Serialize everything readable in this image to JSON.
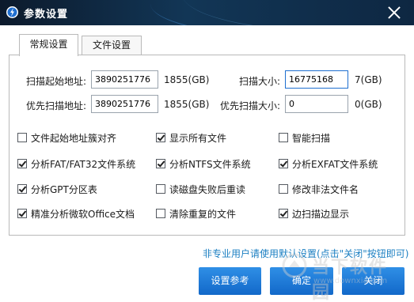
{
  "window": {
    "title": "参数设置"
  },
  "tabs": [
    {
      "label": "常规设置",
      "active": true
    },
    {
      "label": "文件设置",
      "active": false
    }
  ],
  "fields": {
    "scan_start": {
      "label": "扫描起始地址:",
      "value": "3890251776",
      "size": "1855(GB)"
    },
    "scan_size": {
      "label": "扫描大小:",
      "value": "16775168",
      "size": "7(GB)"
    },
    "priority_start": {
      "label": "优先扫描地址:",
      "value": "3890251776",
      "size": "1855(GB)"
    },
    "priority_size": {
      "label": "优先扫描大小:",
      "value": "0",
      "size": "0(GB)"
    }
  },
  "options": [
    {
      "label": "文件起始地址簇对齐",
      "checked": false
    },
    {
      "label": "显示所有文件",
      "checked": true
    },
    {
      "label": "智能扫描",
      "checked": false
    },
    {
      "label": "分析FAT/FAT32文件系统",
      "checked": true
    },
    {
      "label": "分析NTFS文件系统",
      "checked": true
    },
    {
      "label": "分析EXFAT文件系统",
      "checked": true
    },
    {
      "label": "分析GPT分区表",
      "checked": true
    },
    {
      "label": "读磁盘失败后重读",
      "checked": false
    },
    {
      "label": "修改非法文件名",
      "checked": false
    },
    {
      "label": "精准分析微软Office文档",
      "checked": true
    },
    {
      "label": "清除重复的文件",
      "checked": false
    },
    {
      "label": "边扫描边显示",
      "checked": true
    }
  ],
  "hint": "非专业用户请使用默认设置(点击\"关闭\"按钮即可)",
  "buttons": {
    "default": "设置参考",
    "ok": "确定",
    "close": "关闭"
  },
  "watermark": {
    "cn": "当下软件园",
    "en": "www.downxia.com"
  },
  "colors": {
    "title_bg": "#123656",
    "button": "#1a78d6",
    "hint": "#1b7fc2"
  }
}
